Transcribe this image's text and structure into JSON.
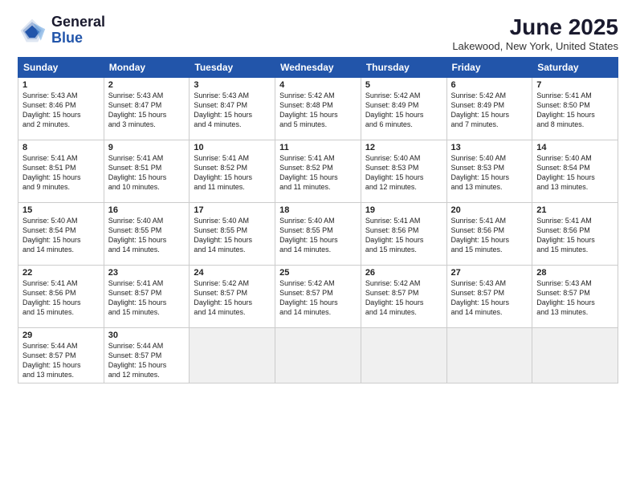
{
  "logo": {
    "line1": "General",
    "line2": "Blue"
  },
  "title": "June 2025",
  "subtitle": "Lakewood, New York, United States",
  "days_of_week": [
    "Sunday",
    "Monday",
    "Tuesday",
    "Wednesday",
    "Thursday",
    "Friday",
    "Saturday"
  ],
  "weeks": [
    [
      {
        "day": 1,
        "text": "Sunrise: 5:43 AM\nSunset: 8:46 PM\nDaylight: 15 hours\nand 2 minutes."
      },
      {
        "day": 2,
        "text": "Sunrise: 5:43 AM\nSunset: 8:47 PM\nDaylight: 15 hours\nand 3 minutes."
      },
      {
        "day": 3,
        "text": "Sunrise: 5:43 AM\nSunset: 8:47 PM\nDaylight: 15 hours\nand 4 minutes."
      },
      {
        "day": 4,
        "text": "Sunrise: 5:42 AM\nSunset: 8:48 PM\nDaylight: 15 hours\nand 5 minutes."
      },
      {
        "day": 5,
        "text": "Sunrise: 5:42 AM\nSunset: 8:49 PM\nDaylight: 15 hours\nand 6 minutes."
      },
      {
        "day": 6,
        "text": "Sunrise: 5:42 AM\nSunset: 8:49 PM\nDaylight: 15 hours\nand 7 minutes."
      },
      {
        "day": 7,
        "text": "Sunrise: 5:41 AM\nSunset: 8:50 PM\nDaylight: 15 hours\nand 8 minutes."
      }
    ],
    [
      {
        "day": 8,
        "text": "Sunrise: 5:41 AM\nSunset: 8:51 PM\nDaylight: 15 hours\nand 9 minutes."
      },
      {
        "day": 9,
        "text": "Sunrise: 5:41 AM\nSunset: 8:51 PM\nDaylight: 15 hours\nand 10 minutes."
      },
      {
        "day": 10,
        "text": "Sunrise: 5:41 AM\nSunset: 8:52 PM\nDaylight: 15 hours\nand 11 minutes."
      },
      {
        "day": 11,
        "text": "Sunrise: 5:41 AM\nSunset: 8:52 PM\nDaylight: 15 hours\nand 11 minutes."
      },
      {
        "day": 12,
        "text": "Sunrise: 5:40 AM\nSunset: 8:53 PM\nDaylight: 15 hours\nand 12 minutes."
      },
      {
        "day": 13,
        "text": "Sunrise: 5:40 AM\nSunset: 8:53 PM\nDaylight: 15 hours\nand 13 minutes."
      },
      {
        "day": 14,
        "text": "Sunrise: 5:40 AM\nSunset: 8:54 PM\nDaylight: 15 hours\nand 13 minutes."
      }
    ],
    [
      {
        "day": 15,
        "text": "Sunrise: 5:40 AM\nSunset: 8:54 PM\nDaylight: 15 hours\nand 14 minutes."
      },
      {
        "day": 16,
        "text": "Sunrise: 5:40 AM\nSunset: 8:55 PM\nDaylight: 15 hours\nand 14 minutes."
      },
      {
        "day": 17,
        "text": "Sunrise: 5:40 AM\nSunset: 8:55 PM\nDaylight: 15 hours\nand 14 minutes."
      },
      {
        "day": 18,
        "text": "Sunrise: 5:40 AM\nSunset: 8:55 PM\nDaylight: 15 hours\nand 14 minutes."
      },
      {
        "day": 19,
        "text": "Sunrise: 5:41 AM\nSunset: 8:56 PM\nDaylight: 15 hours\nand 15 minutes."
      },
      {
        "day": 20,
        "text": "Sunrise: 5:41 AM\nSunset: 8:56 PM\nDaylight: 15 hours\nand 15 minutes."
      },
      {
        "day": 21,
        "text": "Sunrise: 5:41 AM\nSunset: 8:56 PM\nDaylight: 15 hours\nand 15 minutes."
      }
    ],
    [
      {
        "day": 22,
        "text": "Sunrise: 5:41 AM\nSunset: 8:56 PM\nDaylight: 15 hours\nand 15 minutes."
      },
      {
        "day": 23,
        "text": "Sunrise: 5:41 AM\nSunset: 8:57 PM\nDaylight: 15 hours\nand 15 minutes."
      },
      {
        "day": 24,
        "text": "Sunrise: 5:42 AM\nSunset: 8:57 PM\nDaylight: 15 hours\nand 14 minutes."
      },
      {
        "day": 25,
        "text": "Sunrise: 5:42 AM\nSunset: 8:57 PM\nDaylight: 15 hours\nand 14 minutes."
      },
      {
        "day": 26,
        "text": "Sunrise: 5:42 AM\nSunset: 8:57 PM\nDaylight: 15 hours\nand 14 minutes."
      },
      {
        "day": 27,
        "text": "Sunrise: 5:43 AM\nSunset: 8:57 PM\nDaylight: 15 hours\nand 14 minutes."
      },
      {
        "day": 28,
        "text": "Sunrise: 5:43 AM\nSunset: 8:57 PM\nDaylight: 15 hours\nand 13 minutes."
      }
    ],
    [
      {
        "day": 29,
        "text": "Sunrise: 5:44 AM\nSunset: 8:57 PM\nDaylight: 15 hours\nand 13 minutes."
      },
      {
        "day": 30,
        "text": "Sunrise: 5:44 AM\nSunset: 8:57 PM\nDaylight: 15 hours\nand 12 minutes."
      },
      null,
      null,
      null,
      null,
      null
    ]
  ]
}
